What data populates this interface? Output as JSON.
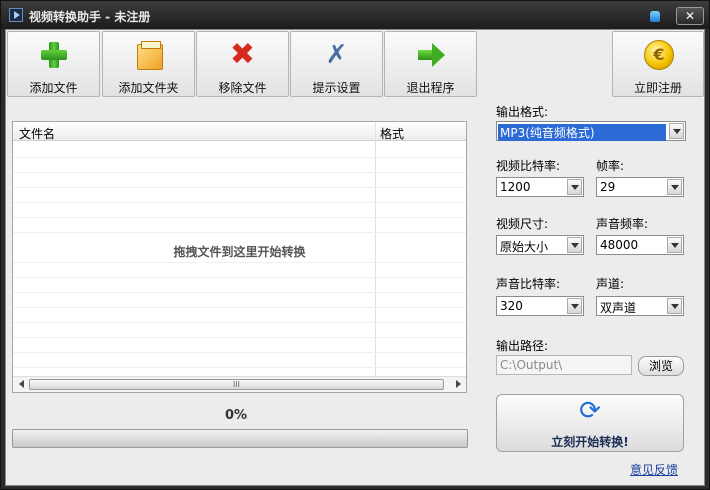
{
  "window": {
    "title": "视频转换助手 - 未注册",
    "close_label": "✕"
  },
  "toolbar": {
    "add_file": "添加文件",
    "add_folder": "添加文件夹",
    "remove_file": "移除文件",
    "settings": "提示设置",
    "exit": "退出程序",
    "register": "立即注册"
  },
  "file_list": {
    "columns": [
      "文件名",
      "格式"
    ],
    "drop_hint": "拖拽文件到这里开始转换",
    "scroll_thumb": "III"
  },
  "progress": {
    "label": "0%",
    "value": 0
  },
  "settings": {
    "output_format_label": "输出格式:",
    "output_format": "MP3(纯音频格式)",
    "video_bitrate_label": "视频比特率:",
    "video_bitrate": "1200",
    "framerate_label": "帧率:",
    "framerate": "29",
    "video_size_label": "视频尺寸:",
    "video_size": "原始大小",
    "sample_rate_label": "声音频率:",
    "sample_rate": "48000",
    "audio_bitrate_label": "声音比特率:",
    "audio_bitrate": "320",
    "channel_label": "声道:",
    "channel": "双声道",
    "output_path_label": "输出路径:",
    "output_path": "C:\\Output\\",
    "browse": "浏览"
  },
  "start_button": "立刻开始转换!",
  "feedback_link": "意见反馈",
  "colors": {
    "accent": "#2c6ad6",
    "title_bar": "#2b2b2b",
    "link": "#1b3fa0"
  }
}
